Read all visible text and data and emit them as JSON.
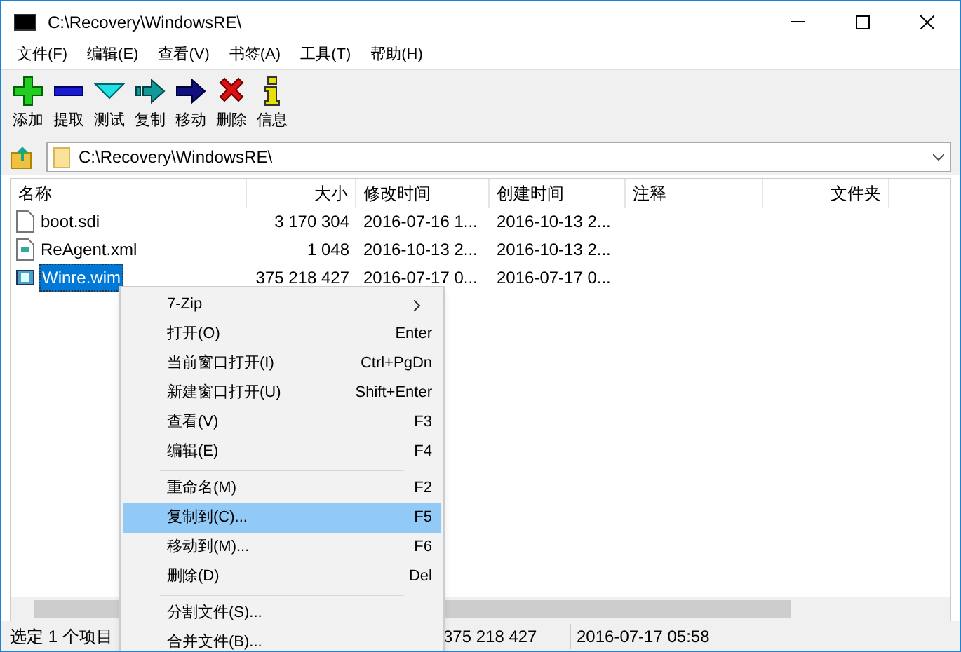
{
  "window": {
    "title": "C:\\Recovery\\WindowsRE\\"
  },
  "menu_bar": [
    "文件(F)",
    "编辑(E)",
    "查看(V)",
    "书签(A)",
    "工具(T)",
    "帮助(H)"
  ],
  "toolbar": [
    {
      "kind": "add",
      "label": "添加"
    },
    {
      "kind": "extract",
      "label": "提取"
    },
    {
      "kind": "test",
      "label": "测试"
    },
    {
      "kind": "copy",
      "label": "复制"
    },
    {
      "kind": "move",
      "label": "移动"
    },
    {
      "kind": "delete",
      "label": "删除"
    },
    {
      "kind": "info",
      "label": "信息"
    }
  ],
  "address": {
    "value": "C:\\Recovery\\WindowsRE\\"
  },
  "table": {
    "columns": [
      "名称",
      "大小",
      "修改时间",
      "创建时间",
      "注释",
      "文件夹"
    ],
    "rows": [
      {
        "kind": "file",
        "selected": false,
        "cells": [
          "boot.sdi",
          "3 170 304",
          "2016-07-16 1...",
          "2016-10-13 2..."
        ]
      },
      {
        "kind": "xml",
        "selected": false,
        "cells": [
          "ReAgent.xml",
          "1 048",
          "2016-10-13 2...",
          "2016-10-13 2..."
        ]
      },
      {
        "kind": "wim",
        "selected": true,
        "cells": [
          "Winre.wim",
          "375 218 427",
          "2016-07-17 0...",
          "2016-07-17 0..."
        ]
      }
    ]
  },
  "context_menu": [
    {
      "kind": "item",
      "label": "7-Zip",
      "submenu": true,
      "selected": false
    },
    {
      "kind": "item",
      "label": "打开(O)",
      "shortcut": "Enter",
      "submenu": false,
      "selected": false
    },
    {
      "kind": "item",
      "label": "当前窗口打开(I)",
      "shortcut": "Ctrl+PgDn",
      "submenu": false,
      "selected": false
    },
    {
      "kind": "item",
      "label": "新建窗口打开(U)",
      "shortcut": "Shift+Enter",
      "submenu": false,
      "selected": false
    },
    {
      "kind": "item",
      "label": "查看(V)",
      "shortcut": "F3",
      "submenu": false,
      "selected": false
    },
    {
      "kind": "item",
      "label": "编辑(E)",
      "shortcut": "F4",
      "submenu": false,
      "selected": false
    },
    {
      "kind": "separator"
    },
    {
      "kind": "item",
      "label": "重命名(M)",
      "shortcut": "F2",
      "submenu": false,
      "selected": false
    },
    {
      "kind": "item",
      "label": "复制到(C)...",
      "shortcut": "F5",
      "submenu": false,
      "selected": true
    },
    {
      "kind": "item",
      "label": "移动到(M)...",
      "shortcut": "F6",
      "submenu": false,
      "selected": false
    },
    {
      "kind": "item",
      "label": "删除(D)",
      "shortcut": "Del",
      "submenu": false,
      "selected": false
    },
    {
      "kind": "separator"
    },
    {
      "kind": "item",
      "label": "分割文件(S)...",
      "submenu": false,
      "selected": false
    },
    {
      "kind": "item",
      "label": "合并文件(B)...",
      "submenu": false,
      "selected": false
    }
  ],
  "status_bar": [
    "选定 1 个项目",
    "375 218 427",
    "2016-07-17 05:58"
  ]
}
